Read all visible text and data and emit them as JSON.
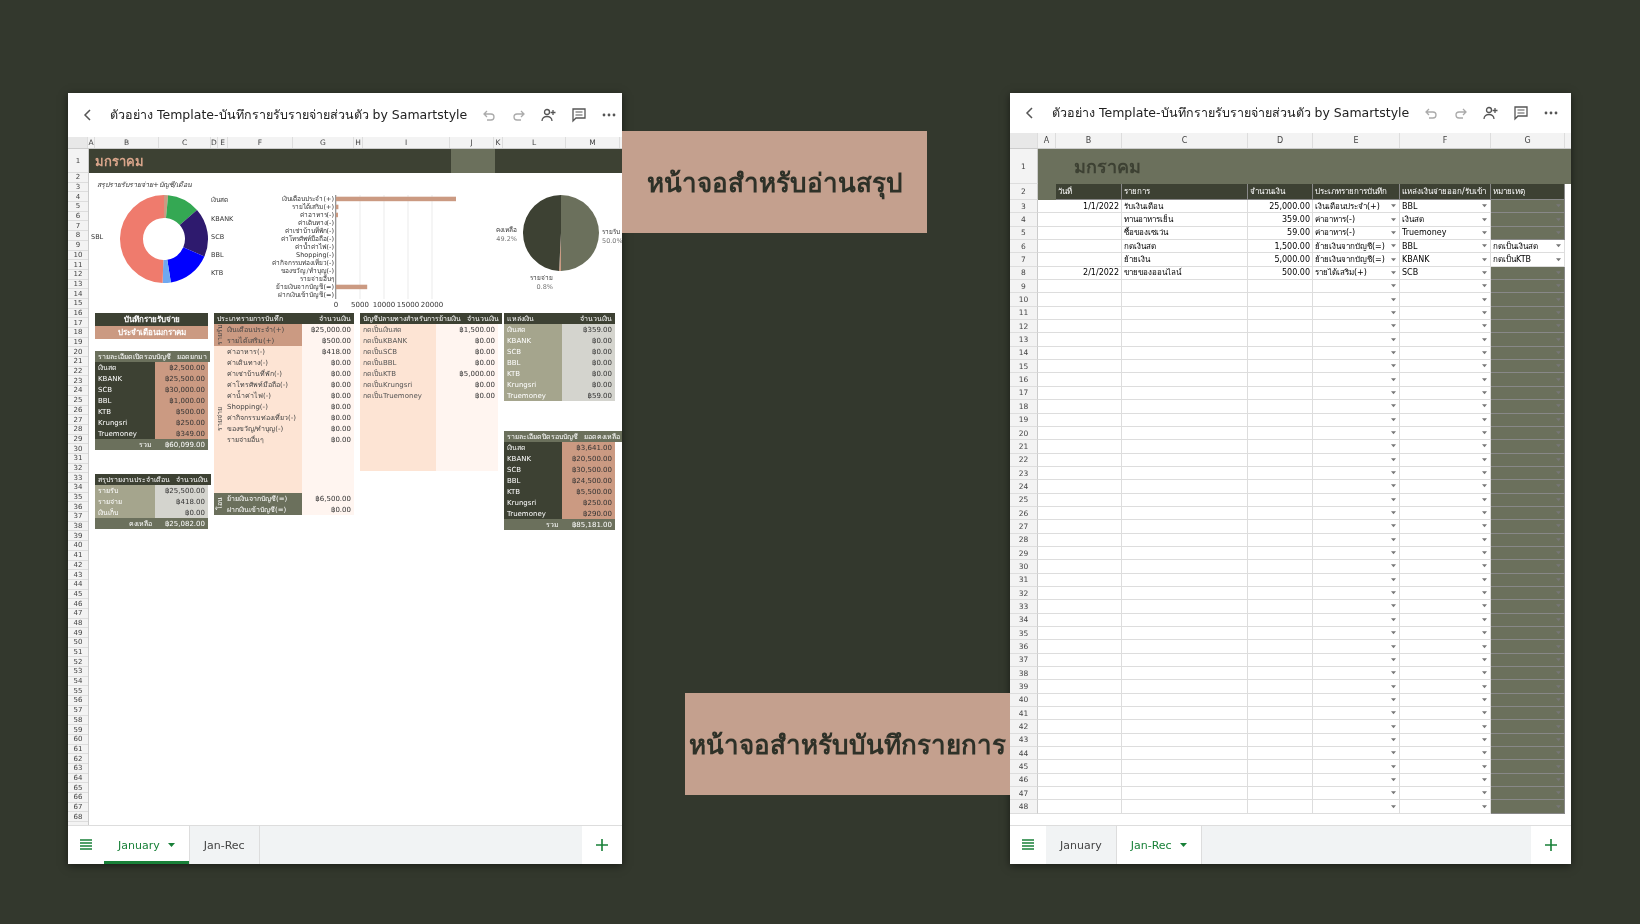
{
  "background_labels": [
    {
      "text": "หน้าจอสำหรับอ่านสรุป"
    },
    {
      "text": "หน้าจอสำหรับบันทึกรายการ"
    }
  ],
  "summary_window": {
    "title": "ตัวอย่าง Template-บันทึกรายรับรายจ่ายส่วนตัว by Samartstyle",
    "columns": [
      "A",
      "B",
      "C",
      "D",
      "E",
      "F",
      "G",
      "H",
      "I",
      "J",
      "K",
      "L",
      "M"
    ],
    "row_numbers": [
      "1",
      "2",
      "3",
      "4",
      "5",
      "6",
      "7",
      "8",
      "9",
      "10",
      "11",
      "12",
      "13",
      "14",
      "15",
      "16",
      "17",
      "18",
      "19",
      "20",
      "21",
      "22",
      "23",
      "24",
      "25",
      "26",
      "27",
      "28",
      "29",
      "30",
      "31",
      "32",
      "33",
      "34",
      "35",
      "36",
      "37",
      "38",
      "39",
      "40",
      "41",
      "42",
      "43",
      "44",
      "45",
      "46",
      "47",
      "48",
      "49",
      "50",
      "51",
      "52",
      "53",
      "54",
      "55",
      "56",
      "57",
      "58",
      "59",
      "60",
      "61",
      "62",
      "63",
      "64",
      "65",
      "66",
      "67",
      "68"
    ],
    "month_title": "มกราคม",
    "caption": "สรุปรายรับรายจ่าย+บัญชี/เดือน",
    "donut": {
      "left_labels": [
        "SBL"
      ],
      "right_labels": [
        "เงินสด",
        "KBANK",
        "SCB",
        "BBL",
        "KTB"
      ]
    },
    "bar_chart": {
      "chart_data": {
        "type": "bar",
        "orientation": "horizontal",
        "categories": [
          "เงินเดือนประจำ(+)",
          "รายได้เสริม(+)",
          "ค่าอาหาร(-)",
          "ค่าเดินทาง(-)",
          "ค่าเช่าบ้านที่พัก(-)",
          "ค่าโทรศัพท์มือถือ(-)",
          "ค่าน้ำค่าไฟ(-)",
          "Shopping(-)",
          "ค่ากิจกรรมท่องเที่ยว(-)",
          "ของขวัญ/ทำบุญ(-)",
          "รายจ่ายอื่นๆ",
          "ย้ายเงินจากบัญชี(=)",
          "ฝากเงินเข้าบัญชี(=)"
        ],
        "values": [
          25000,
          500,
          418,
          0,
          0,
          0,
          0,
          0,
          0,
          0,
          0,
          6500,
          0
        ],
        "xlim": [
          0,
          25000
        ],
        "xticks": [
          0,
          5000,
          10000,
          15000,
          20000
        ],
        "grid": true
      }
    },
    "pie_chart": {
      "chart_data": {
        "type": "pie",
        "categories": [
          "รายรับ",
          "รายจ่าย",
          "คงเหลือ"
        ],
        "values": [
          50.0,
          0.8,
          49.2
        ],
        "value_labels": [
          "50.0%",
          "0.8%",
          "49.2%"
        ]
      }
    },
    "banner": [
      "บันทึกรายรับจ่าย",
      "ประจำเดือนมกราคม"
    ],
    "tables": [
      {
        "kind": "opening",
        "header": [
          "รายละเอียดเปิดรอบบัญชี",
          "ยอดยกมา"
        ],
        "rows": [
          [
            "เงินสด",
            "฿2,500.00"
          ],
          [
            "KBANK",
            "฿25,500.00"
          ],
          [
            "SCB",
            "฿30,000.00"
          ],
          [
            "BBL",
            "฿1,000.00"
          ],
          [
            "KTB",
            "฿500.00"
          ],
          [
            "Krungsri",
            "฿250.00"
          ],
          [
            "Truemoney",
            "฿349.00"
          ]
        ],
        "total": [
          "รวม",
          "฿60,099.00"
        ]
      },
      {
        "kind": "report",
        "header": [
          "สรุปรายงานประจำเดือน",
          "จำนวนเงิน"
        ],
        "rows": [
          [
            "รายรับ",
            "฿25,500.00"
          ],
          [
            "รายจ่าย",
            "฿418.00"
          ],
          [
            "เงินเก็บ",
            "฿0.00"
          ]
        ],
        "total": [
          "คงเหลือ",
          "฿25,082.00"
        ]
      },
      {
        "kind": "categories",
        "header": [
          "ประเภทรายการบันทึก",
          "จำนวนเงิน"
        ],
        "groups": [
          {
            "kind": "income",
            "label": "รายรับ",
            "rows": [
              [
                "เงินเดือนประจำ(+)",
                "฿25,000.00"
              ],
              [
                "รายได้เสริม(+)",
                "฿500.00"
              ]
            ]
          },
          {
            "kind": "expense",
            "label": "รายจ่าย",
            "rows": [
              [
                "ค่าอาหาร(-)",
                "฿418.00"
              ],
              [
                "ค่าเดินทาง(-)",
                "฿0.00"
              ],
              [
                "ค่าเช่าบ้านที่พัก(-)",
                "฿0.00"
              ],
              [
                "ค่าโทรศัพท์มือถือ(-)",
                "฿0.00"
              ],
              [
                "ค่าน้ำค่าไฟ(-)",
                "฿0.00"
              ],
              [
                "Shopping(-)",
                "฿0.00"
              ],
              [
                "ค่ากิจกรรมท่องเที่ยว(-)",
                "฿0.00"
              ],
              [
                "ของขวัญ/ทำบุญ(-)",
                "฿0.00"
              ],
              [
                "รายจ่ายอื่นๆ",
                "฿0.00"
              ]
            ]
          },
          {
            "kind": "transfer",
            "label": "โอน",
            "rows": [
              [
                "ย้ายเงินจากบัญชี(=)",
                "฿6,500.00"
              ],
              [
                "ฝากเงินเข้าบัญชี(=)",
                "฿0.00"
              ]
            ]
          }
        ]
      },
      {
        "kind": "destinations",
        "header": [
          "บัญชีปลายทางสำหรับการย้ายเงิน",
          "จำนวนเงิน"
        ],
        "rows": [
          [
            "กดเป็นเงินสด",
            "฿1,500.00"
          ],
          [
            "กดเป็นKBANK",
            "฿0.00"
          ],
          [
            "กดเป็นSCB",
            "฿0.00"
          ],
          [
            "กดเป็นBBL",
            "฿0.00"
          ],
          [
            "กดเป็นKTB",
            "฿5,000.00"
          ],
          [
            "กดเป็นKrungsri",
            "฿0.00"
          ],
          [
            "กดเป็นTruemoney",
            "฿0.00"
          ]
        ]
      },
      {
        "kind": "sources",
        "header": [
          "แหล่งเงิน",
          "จำนวนเงิน"
        ],
        "rows": [
          [
            "เงินสด",
            "฿359.00"
          ],
          [
            "KBANK",
            "฿0.00"
          ],
          [
            "SCB",
            "฿0.00"
          ],
          [
            "BBL",
            "฿0.00"
          ],
          [
            "KTB",
            "฿0.00"
          ],
          [
            "Krungsri",
            "฿0.00"
          ],
          [
            "Truemoney",
            "฿59.00"
          ]
        ]
      },
      {
        "kind": "closing",
        "header": [
          "รายละเอียดปิดรอบบัญชี",
          "ยอดคงเหลือ"
        ],
        "rows": [
          [
            "เงินสด",
            "฿3,641.00"
          ],
          [
            "KBANK",
            "฿20,500.00"
          ],
          [
            "SCB",
            "฿30,500.00"
          ],
          [
            "BBL",
            "฿24,500.00"
          ],
          [
            "KTB",
            "฿5,500.00"
          ],
          [
            "Krungsri",
            "฿250.00"
          ],
          [
            "Truemoney",
            "฿290.00"
          ]
        ],
        "total": [
          "รวม",
          "฿85,181.00"
        ]
      }
    ],
    "sheet_tabs": [
      {
        "label": "January",
        "selected": true
      },
      {
        "label": "Jan-Rec",
        "selected": false
      }
    ]
  },
  "record_window": {
    "title": "ตัวอย่าง Template-บันทึกรายรับรายจ่ายส่วนตัว by Samartstyle",
    "columns": [
      "A",
      "B",
      "C",
      "D",
      "E",
      "F",
      "G"
    ],
    "month_row": {
      "number": "1",
      "title": "มกราคม"
    },
    "header_row": {
      "number": "2",
      "cells": [
        "วันที่",
        "รายการ",
        "จำนวนเงิน",
        "ประเภทรายการบันทึก",
        "แหล่งเงินจ่ายออก/รับเข้า",
        "หมายเหตุ"
      ]
    },
    "rows": [
      {
        "number": "3",
        "date": "1/1/2022",
        "item": "รับเงินเดือน",
        "amount": "25,000.00",
        "type": "เงินเดือนประจำ(+)",
        "source": "BBL"
      },
      {
        "number": "4",
        "item": "ทานอาหารเย็น",
        "amount": "359.00",
        "type": "ค่าอาหาร(-)",
        "source": "เงินสด"
      },
      {
        "number": "5",
        "item": "ซื้อของเซเว่น",
        "amount": "59.00",
        "type": "ค่าอาหาร(-)",
        "source": "Truemoney"
      },
      {
        "number": "6",
        "item": "กดเงินสด",
        "amount": "1,500.00",
        "type": "ย้ายเงินจากบัญชี(=)",
        "source": "BBL",
        "note": "กดเป็นเงินสด"
      },
      {
        "number": "7",
        "item": "ย้ายเงิน",
        "amount": "5,000.00",
        "type": "ย้ายเงินจากบัญชี(=)",
        "source": "KBANK",
        "note": "กดเป็นKTB"
      },
      {
        "number": "8",
        "date": "2/1/2022",
        "item": "ขายของออนไลน์",
        "amount": "500.00",
        "type": "รายได้เสริม(+)",
        "source": "SCB"
      }
    ],
    "empty_rows": [
      "9",
      "10",
      "11",
      "12",
      "13",
      "14",
      "15",
      "16",
      "17",
      "18",
      "19",
      "20",
      "21",
      "22",
      "23",
      "24",
      "25",
      "26",
      "27",
      "28",
      "29",
      "30",
      "31",
      "32",
      "33",
      "34",
      "35",
      "36",
      "37",
      "38",
      "39",
      "40",
      "41",
      "42",
      "43",
      "44",
      "45",
      "46",
      "47",
      "48"
    ],
    "sheet_tabs": [
      {
        "label": "January",
        "selected": false
      },
      {
        "label": "Jan-Rec",
        "selected": true
      }
    ]
  }
}
